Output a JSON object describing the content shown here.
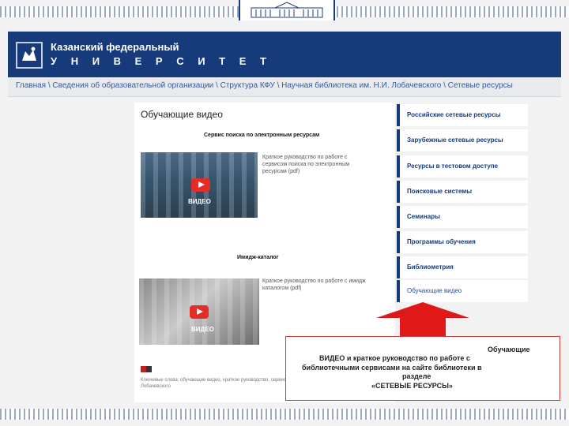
{
  "header": {
    "university_name": "Казанский федеральный",
    "university_word": "У Н И В Е Р С И Т Е Т"
  },
  "breadcrumb": {
    "text": "Главная \\ Сведения об образовательной организации \\ Структура КФУ \\ Научная библиотека им. Н.И. Лобачевского \\ Сетевые ресурсы"
  },
  "content": {
    "title": "Обучающие видео",
    "section1_title": "Сервис поиска по электронным ресурсам",
    "section1_link": "Краткое руководство по работе с сервисом поиска по электронным ресурсам (pdf)",
    "section1_thumb_caption": "ВИДЕО",
    "section2_title": "Имидж-каталог",
    "section2_link": "Краткое руководство по работе с имидж каталогом (pdf)",
    "section2_thumb_caption": "ВИДЕО",
    "footer_text": "Ключевые слова: обучающие видео, краткое руководство, сервис, Лобачевского"
  },
  "sidebar": {
    "items": [
      {
        "label": "Российские сетевые ресурсы"
      },
      {
        "label": "Зарубежные сетевые ресурсы"
      },
      {
        "label": "Ресурсы в тестовом доступе"
      },
      {
        "label": "Поисковые системы"
      },
      {
        "label": "Семинары"
      },
      {
        "label": "Программы обучения"
      },
      {
        "label": "Библиометрия"
      },
      {
        "label": "Обучающие видео"
      }
    ]
  },
  "callout": {
    "line1": "Обучающие",
    "line2": "ВИДЕО и краткое руководство по работе с",
    "line3": "библиотечными сервисами на сайте библиотеки в",
    "line4": "разделе",
    "line5": "«СЕТЕВЫЕ РЕСУРСЫ»"
  },
  "colors": {
    "header_blue": "#173b7a",
    "arrow_red": "#e01818",
    "play_red": "#e52d27"
  }
}
